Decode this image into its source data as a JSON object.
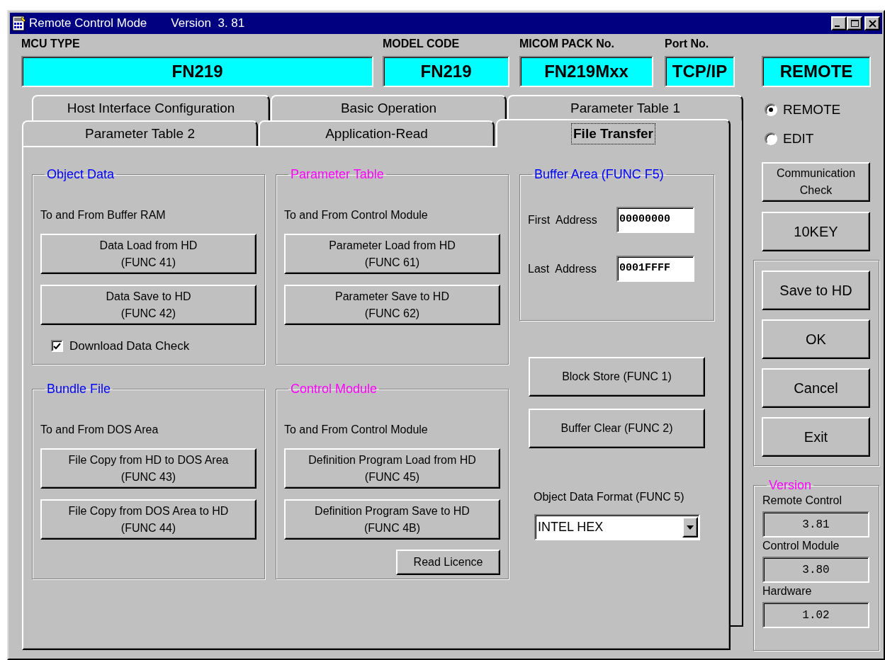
{
  "window": {
    "title": "Remote Control Mode",
    "version": "Version  3. 81"
  },
  "header_fields": [
    {
      "label": "MCU TYPE",
      "value": "FN219"
    },
    {
      "label": "MODEL CODE",
      "value": "FN219"
    },
    {
      "label": "MICOM PACK No.",
      "value": "FN219Mxx"
    },
    {
      "label": "Port No.",
      "value": "TCP/IP"
    },
    {
      "value": "REMOTE"
    }
  ],
  "tabs_back_row": [
    {
      "label": "Host Interface Configuration",
      "selected": false
    },
    {
      "label": "Basic Operation",
      "selected": false
    },
    {
      "label": "Parameter Table 1",
      "selected": false
    }
  ],
  "tabs_front_row": [
    {
      "label": "Parameter Table 2",
      "selected": false
    },
    {
      "label": "Application-Read",
      "selected": false
    },
    {
      "label": "File Transfer",
      "selected": true
    }
  ],
  "groups": [
    {
      "title": "Object Data",
      "color": "#0000ff",
      "description": "To and From Buffer RAM",
      "buttons": [
        "Data Load from HD\n(FUNC 41)",
        "Data Save to HD\n(FUNC 42)"
      ],
      "checkbox": {
        "label": "Download Data Check",
        "checked": true
      }
    },
    {
      "title": "Parameter Table",
      "color": "#ff00ff",
      "description": "To and From Control Module",
      "buttons": [
        "Parameter Load from HD\n(FUNC 61)",
        "Parameter Save to HD\n(FUNC 62)"
      ]
    },
    {
      "title": "Bundle File",
      "color": "#0000ff",
      "description": "To and From DOS Area",
      "buttons": [
        "File Copy from HD to DOS Area\n(FUNC 43)",
        "File Copy from DOS Area to HD\n(FUNC 44)"
      ]
    },
    {
      "title": "Control Module",
      "color": "#ff00ff",
      "description": "To and From Control Module",
      "buttons": [
        "Definition Program Load from HD\n(FUNC 45)",
        "Definition Program Save to HD\n(FUNC 4B)"
      ],
      "extra_button": "Read Licence"
    }
  ],
  "buffer_area": {
    "title": "Buffer Area (FUNC F5)",
    "color": "#0000ff",
    "fields": [
      {
        "label": "First  Address",
        "value": "00000000"
      },
      {
        "label": "Last  Address",
        "value": "0001FFFF"
      }
    ]
  },
  "buffer_buttons": [
    "Block Store (FUNC 1)",
    "Buffer Clear (FUNC 2)"
  ],
  "object_data_format": {
    "label": "Object Data Format (FUNC 5)",
    "value": "INTEL HEX"
  },
  "mode_options": [
    {
      "label": "REMOTE",
      "selected": true
    },
    {
      "label": "EDIT",
      "selected": false
    }
  ],
  "side_buttons": [
    "Communication\nCheck",
    "10KEY"
  ],
  "action_buttons": [
    "Save to HD",
    "OK",
    "Cancel",
    "Exit"
  ],
  "version": {
    "title": "Version",
    "color": "#ff00ff",
    "items": [
      {
        "label": "Remote Control",
        "value": "3.81"
      },
      {
        "label": "Control Module",
        "value": "3.80"
      },
      {
        "label": "Hardware",
        "value": "1.02"
      }
    ]
  }
}
